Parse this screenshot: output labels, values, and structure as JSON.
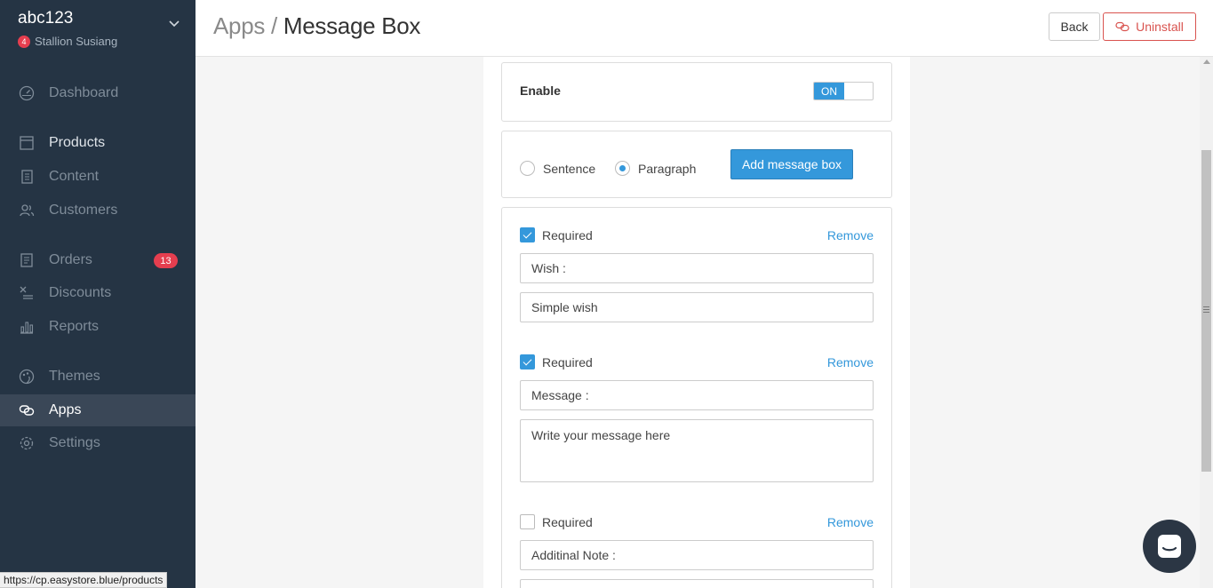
{
  "sidebar": {
    "store_name": "abc123",
    "user_badge": "4",
    "user_name": "Stallion Susiang",
    "items": [
      {
        "label": "Dashboard",
        "icon": "dashboard-icon"
      },
      {
        "label": "Products",
        "icon": "products-icon"
      },
      {
        "label": "Content",
        "icon": "content-icon"
      },
      {
        "label": "Customers",
        "icon": "customers-icon"
      },
      {
        "label": "Orders",
        "icon": "orders-icon",
        "badge": "13"
      },
      {
        "label": "Discounts",
        "icon": "discounts-icon"
      },
      {
        "label": "Reports",
        "icon": "reports-icon"
      },
      {
        "label": "Themes",
        "icon": "themes-icon"
      },
      {
        "label": "Apps",
        "icon": "apps-icon",
        "active": true
      },
      {
        "label": "Settings",
        "icon": "settings-icon"
      }
    ]
  },
  "header": {
    "breadcrumb_root": "Apps",
    "breadcrumb_sep": "/",
    "page_title": "Message Box",
    "back_label": "Back",
    "uninstall_label": "Uninstall"
  },
  "enable": {
    "label": "Enable",
    "toggle_text": "ON",
    "value": true
  },
  "type_selector": {
    "options": [
      "Sentence",
      "Paragraph"
    ],
    "selected": "Paragraph",
    "add_label": "Add message box"
  },
  "fields": [
    {
      "required_label": "Required",
      "required": true,
      "remove_label": "Remove",
      "label_value": "Wish :",
      "placeholder_value": "Simple wish",
      "multiline": false
    },
    {
      "required_label": "Required",
      "required": true,
      "remove_label": "Remove",
      "label_value": "Message :",
      "placeholder_value": "Write your message here",
      "multiline": true
    },
    {
      "required_label": "Required",
      "required": false,
      "remove_label": "Remove",
      "label_value": "Additinal Note :",
      "placeholder_value": "",
      "multiline": false
    }
  ],
  "status_url": "https://cp.easystore.blue/products",
  "colors": {
    "sidebar_bg": "#253444",
    "accent": "#3498db",
    "danger": "#d9534f",
    "badge": "#e53e4f"
  }
}
